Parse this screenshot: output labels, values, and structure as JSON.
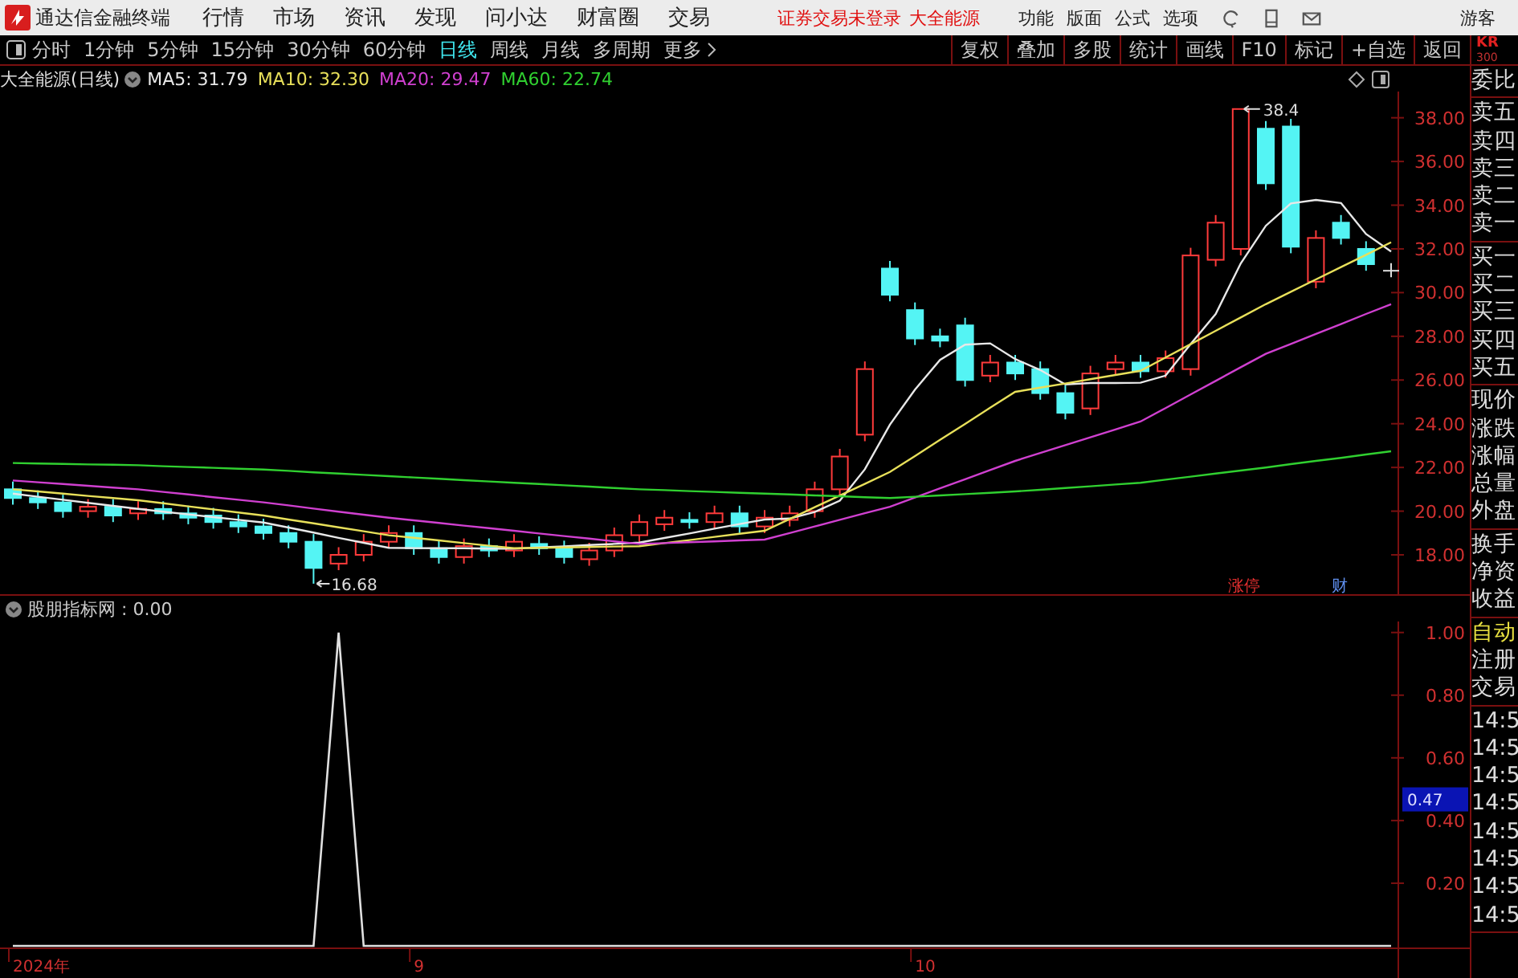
{
  "menubar": {
    "app_title": "通达信金融终端",
    "menus": [
      "行情",
      "市场",
      "资讯",
      "发现",
      "问小达",
      "财富圈",
      "交易"
    ],
    "notice": "证券交易未登录",
    "stock": "大全能源",
    "tools": [
      "功能",
      "版面",
      "公式",
      "选项"
    ],
    "user": "游客"
  },
  "periods": [
    {
      "label": "分时",
      "selected": false
    },
    {
      "label": "1分钟",
      "selected": false
    },
    {
      "label": "5分钟",
      "selected": false
    },
    {
      "label": "15分钟",
      "selected": false
    },
    {
      "label": "30分钟",
      "selected": false
    },
    {
      "label": "60分钟",
      "selected": false
    },
    {
      "label": "日线",
      "selected": true
    },
    {
      "label": "周线",
      "selected": false
    },
    {
      "label": "月线",
      "selected": false
    },
    {
      "label": "多周期",
      "selected": false
    },
    {
      "label": "更多",
      "selected": false
    }
  ],
  "chart_tools": [
    "复权",
    "叠加",
    "多股",
    "统计",
    "画线",
    "F10",
    "标记",
    "+自选",
    "返回"
  ],
  "legend": {
    "title": "大全能源(日线)",
    "averages": [
      "MA5: 31.79",
      "MA10: 32.30",
      "MA20: 29.47",
      "MA60: 22.74"
    ]
  },
  "price_chart": {
    "chart_data": {
      "type": "candlestick",
      "ylim": [
        16.2,
        39.2
      ],
      "yticks": [
        {
          "value": 38,
          "label": "38.00"
        },
        {
          "value": 36,
          "label": "36.00"
        },
        {
          "value": 34,
          "label": "34.00"
        },
        {
          "value": 32,
          "label": "32.00"
        },
        {
          "value": 30,
          "label": "30.00"
        },
        {
          "value": 28,
          "label": "28.00"
        },
        {
          "value": 26,
          "label": "26.00"
        },
        {
          "value": 24,
          "label": "24.00"
        },
        {
          "value": 22,
          "label": "22.00"
        },
        {
          "value": 20,
          "label": "20.00"
        },
        {
          "value": 18,
          "label": "18.00"
        }
      ],
      "ohlc": [
        [
          21,
          21.35,
          20.3,
          20.6
        ],
        [
          20.6,
          20.95,
          20.1,
          20.4
        ],
        [
          20.4,
          20.75,
          19.7,
          20
        ],
        [
          20,
          20.55,
          19.7,
          20.2
        ],
        [
          20.2,
          20.55,
          19.5,
          19.8
        ],
        [
          19.9,
          20.45,
          19.6,
          20.1
        ],
        [
          20.1,
          20.45,
          19.6,
          19.9
        ],
        [
          19.9,
          20.25,
          19.4,
          19.7
        ],
        [
          19.8,
          20.15,
          19.2,
          19.5
        ],
        [
          19.5,
          19.85,
          19,
          19.3
        ],
        [
          19.3,
          19.65,
          18.7,
          19
        ],
        [
          19,
          19.35,
          18.3,
          18.6
        ],
        [
          18.6,
          18.95,
          16.68,
          17.4
        ],
        [
          17.6,
          18.35,
          17.3,
          18
        ],
        [
          18,
          18.95,
          17.7,
          18.6
        ],
        [
          18.6,
          19.35,
          18.3,
          19
        ],
        [
          19,
          19.35,
          18,
          18.3
        ],
        [
          18.3,
          18.65,
          17.6,
          17.9
        ],
        [
          17.9,
          18.75,
          17.6,
          18.4
        ],
        [
          18.4,
          18.75,
          17.9,
          18.2
        ],
        [
          18.2,
          18.95,
          17.9,
          18.6
        ],
        [
          18.5,
          18.85,
          18,
          18.3
        ],
        [
          18.3,
          18.65,
          17.6,
          17.9
        ],
        [
          17.8,
          18.55,
          17.5,
          18.2
        ],
        [
          18.2,
          19.25,
          17.9,
          18.9
        ],
        [
          18.9,
          19.85,
          18.6,
          19.5
        ],
        [
          19.4,
          20.05,
          19.1,
          19.7
        ],
        [
          19.6,
          19.95,
          19.2,
          19.5
        ],
        [
          19.5,
          20.25,
          19.2,
          19.9
        ],
        [
          19.9,
          20.25,
          19,
          19.3
        ],
        [
          19.3,
          20.05,
          19,
          19.7
        ],
        [
          19.6,
          20.25,
          19.3,
          19.9
        ],
        [
          20,
          21.35,
          19.7,
          21
        ],
        [
          21,
          22.85,
          20.7,
          22.5
        ],
        [
          23.5,
          26.85,
          23.2,
          26.5
        ],
        [
          31.1,
          31.45,
          29.6,
          29.9
        ],
        [
          29.2,
          29.55,
          27.6,
          27.9
        ],
        [
          28,
          28.35,
          27.5,
          27.8
        ],
        [
          28.5,
          28.85,
          25.7,
          26
        ],
        [
          26.2,
          27.15,
          25.9,
          26.8
        ],
        [
          26.8,
          27.15,
          26,
          26.3
        ],
        [
          26.5,
          26.85,
          25.1,
          25.4
        ],
        [
          25.4,
          25.75,
          24.2,
          24.5
        ],
        [
          24.7,
          26.65,
          24.4,
          26.3
        ],
        [
          26.5,
          27.15,
          26.2,
          26.8
        ],
        [
          26.8,
          27.15,
          26.1,
          26.4
        ],
        [
          26.4,
          27.35,
          26.1,
          27
        ],
        [
          26.5,
          32.05,
          26.2,
          31.7
        ],
        [
          31.5,
          33.55,
          31.2,
          33.2
        ],
        [
          32,
          38.4,
          31.7,
          38.4
        ],
        [
          37.5,
          37.85,
          34.7,
          35
        ],
        [
          37.6,
          37.95,
          31.8,
          32.1
        ],
        [
          30.5,
          32.85,
          30.2,
          32.5
        ],
        [
          33.2,
          33.55,
          32.2,
          32.5
        ],
        [
          32,
          32.35,
          31,
          31.3
        ],
        [
          31,
          31.35,
          30.7,
          31
        ]
      ],
      "series": [
        {
          "type": "line",
          "color": "#e8e8e8",
          "values": [
            20.8,
            20.66,
            20.52,
            20.38,
            20.24,
            20.1,
            19.98,
            19.85,
            19.73,
            19.6,
            19.48,
            19.25,
            19.02,
            18.78,
            18.55,
            18.32,
            18.31,
            18.3,
            18.3,
            18.29,
            18.28,
            18.34,
            18.39,
            18.45,
            18.5,
            18.56,
            18.77,
            18.98,
            19.2,
            19.41,
            19.62,
            19.66,
            19.96,
            20.48,
            21.92,
            23.96,
            25.56,
            26.92,
            27.62,
            27.68,
            26.96,
            26.46,
            25.8,
            25.86,
            25.86,
            25.88,
            26.2,
            27.64,
            29.02,
            31.34,
            33.06,
            34.08,
            34.24,
            34.1,
            32.68,
            31.88
          ]
        },
        {
          "type": "line",
          "color": "#e8e05a",
          "values": [
            21,
            20.9,
            20.8,
            20.7,
            20.6,
            20.5,
            20.36,
            20.22,
            20.08,
            19.94,
            19.8,
            19.62,
            19.44,
            19.26,
            19.08,
            18.9,
            18.78,
            18.66,
            18.54,
            18.42,
            18.3,
            18.32,
            18.34,
            18.36,
            18.38,
            18.4,
            18.54,
            18.68,
            18.82,
            18.96,
            19.1,
            19.64,
            20.18,
            20.71,
            21.25,
            21.79,
            22.52,
            23.26,
            23.99,
            24.73,
            25.46,
            25.65,
            25.84,
            26.04,
            26.23,
            26.42,
            27.03,
            27.64,
            28.25,
            28.86,
            29.47,
            30.04,
            30.6,
            31.17,
            31.73,
            32.3
          ]
        },
        {
          "type": "line",
          "color": "#d040d0",
          "values": [
            21.4,
            21.32,
            21.24,
            21.16,
            21.08,
            21,
            20.88,
            20.76,
            20.64,
            20.52,
            20.4,
            20.26,
            20.12,
            19.98,
            19.84,
            19.7,
            19.58,
            19.46,
            19.34,
            19.22,
            19.1,
            18.98,
            18.86,
            18.74,
            18.62,
            18.5,
            18.54,
            18.58,
            18.62,
            18.66,
            18.7,
            19,
            19.3,
            19.6,
            19.9,
            20.2,
            20.62,
            21.04,
            21.46,
            21.88,
            22.3,
            22.66,
            23.02,
            23.38,
            23.74,
            24.1,
            24.72,
            25.34,
            25.96,
            26.58,
            27.2,
            27.65,
            28.11,
            28.56,
            29.02,
            29.47
          ]
        },
        {
          "type": "line",
          "color": "#30d030",
          "values": [
            22.2,
            22.18,
            22.16,
            22.14,
            22.12,
            22.1,
            22.06,
            22.02,
            21.98,
            21.94,
            21.9,
            21.84,
            21.78,
            21.72,
            21.66,
            21.6,
            21.54,
            21.48,
            21.42,
            21.36,
            21.3,
            21.24,
            21.18,
            21.12,
            21.06,
            21,
            20.96,
            20.92,
            20.88,
            20.84,
            20.8,
            20.76,
            20.72,
            20.68,
            20.64,
            20.6,
            20.66,
            20.72,
            20.78,
            20.84,
            20.9,
            20.98,
            21.06,
            21.14,
            21.22,
            21.3,
            21.44,
            21.58,
            21.72,
            21.86,
            22,
            22.15,
            22.3,
            22.44,
            22.59,
            22.74
          ]
        }
      ]
    },
    "annotations": {
      "high": "38.4",
      "low": "16.68"
    },
    "markers": [
      "涨停",
      "财"
    ]
  },
  "x_axis": [
    "2024年",
    "9",
    "10"
  ],
  "indicator": {
    "label": "股朋指标网 : 0.00",
    "cursor_value": "0.47",
    "chart_data": {
      "type": "line",
      "ylim": [
        0,
        1.03
      ],
      "yticks": [
        {
          "value": 1,
          "label": "1.00"
        },
        {
          "value": 0.8,
          "label": "0.80"
        },
        {
          "value": 0.6,
          "label": "0.60"
        },
        {
          "value": 0.4,
          "label": "0.40"
        },
        {
          "value": 0.2,
          "label": "0.20"
        }
      ],
      "series": [
        {
          "color": "#e0e0e0",
          "values": [
            0,
            0,
            0,
            0,
            0,
            0,
            0,
            0,
            0,
            0,
            0,
            0,
            0,
            1,
            0,
            0,
            0,
            0,
            0,
            0,
            0,
            0,
            0,
            0,
            0,
            0,
            0,
            0,
            0,
            0,
            0,
            0,
            0,
            0,
            0,
            0,
            0,
            0,
            0,
            0,
            0,
            0,
            0,
            0,
            0,
            0,
            0,
            0,
            0,
            0,
            0,
            0,
            0,
            0,
            0,
            0
          ]
        }
      ]
    }
  },
  "side_panel": {
    "code": "KR",
    "code_sub": "300",
    "groups": [
      {
        "items": [
          {
            "label": "委比",
            "active": false
          }
        ]
      },
      {
        "items": [
          {
            "label": "卖五",
            "active": false
          },
          {
            "label": "卖四",
            "active": false
          },
          {
            "label": "卖三",
            "active": false
          },
          {
            "label": "卖二",
            "active": false
          },
          {
            "label": "卖一",
            "active": false
          }
        ]
      },
      {
        "items": [
          {
            "label": "买一",
            "active": false
          },
          {
            "label": "买二",
            "active": false
          },
          {
            "label": "买三",
            "active": false
          },
          {
            "label": "买四",
            "active": false
          },
          {
            "label": "买五",
            "active": false
          }
        ]
      },
      {
        "items": [
          {
            "label": "现价",
            "active": false
          },
          {
            "label": "涨跌",
            "active": false
          },
          {
            "label": "涨幅",
            "active": false
          },
          {
            "label": "总量",
            "active": false
          },
          {
            "label": "外盘",
            "active": false
          }
        ]
      },
      {
        "items": [
          {
            "label": "换手",
            "active": false
          },
          {
            "label": "净资",
            "active": false
          },
          {
            "label": "收益",
            "active": false
          }
        ]
      },
      {
        "items": [
          {
            "label": "自动",
            "active": true
          },
          {
            "label": "注册",
            "active": false
          },
          {
            "label": "交易",
            "active": false
          }
        ]
      },
      {
        "items": [
          {
            "label": "14:5",
            "active": false
          },
          {
            "label": "14:5",
            "active": false
          },
          {
            "label": "14:5",
            "active": false
          },
          {
            "label": "14:5",
            "active": false
          },
          {
            "label": "14:5",
            "active": false
          },
          {
            "label": "14:5",
            "active": false
          },
          {
            "label": "14:5",
            "active": false
          },
          {
            "label": "14:5",
            "active": false
          }
        ]
      }
    ]
  }
}
